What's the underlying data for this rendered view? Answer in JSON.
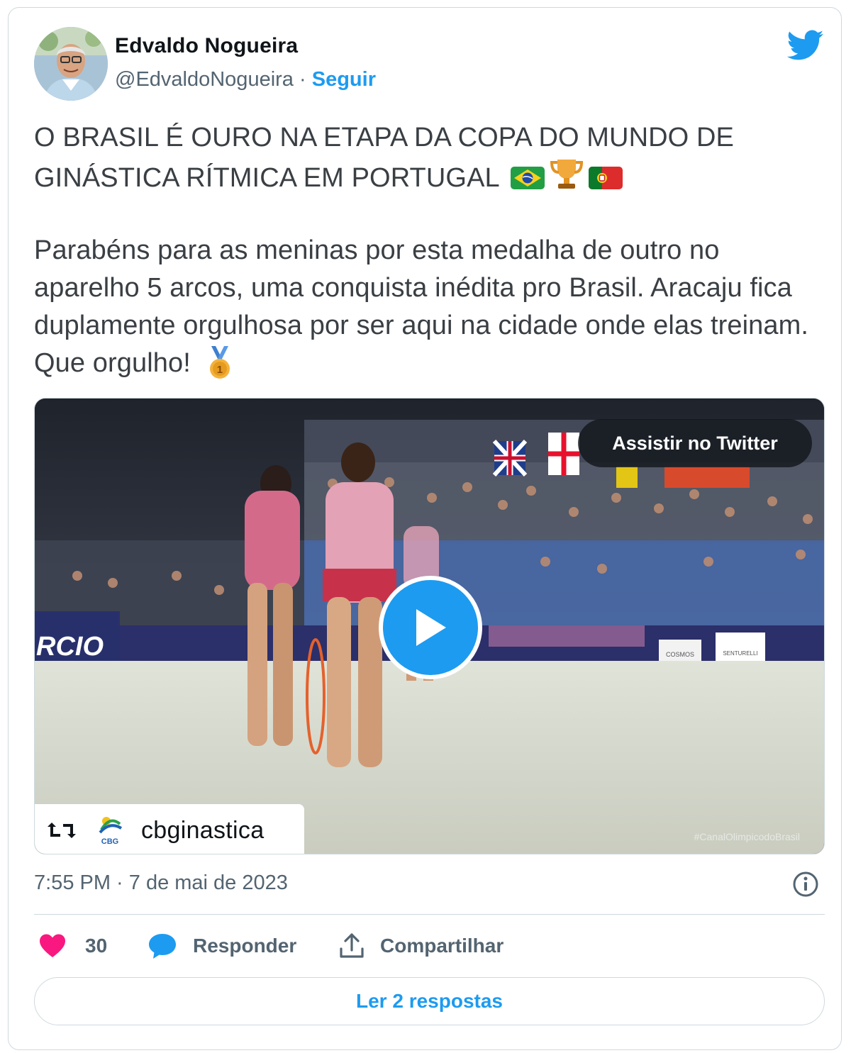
{
  "author": {
    "name": "Edvaldo Nogueira",
    "handle": "@EdvaldoNogueira",
    "separator": "·",
    "follow_label": "Seguir"
  },
  "tweet": {
    "paragraph1": "O BRASIL É OURO NA ETAPA DA COPA DO MUNDO DE GINÁSTICA RÍTMICA EM PORTUGAL",
    "paragraph1_emojis": [
      "brazil-flag",
      "trophy",
      "portugal-flag"
    ],
    "paragraph2": "Parabéns para as meninas por esta medalha de outro no aparelho 5 arcos, uma conquista inédita pro Brasil. Aracaju fica duplamente orgulhosa por ser aqui na cidade onde elas treinam. Que orgulho!",
    "paragraph2_emojis": [
      "first-place-medal"
    ]
  },
  "media": {
    "watch_label": "Assistir no Twitter",
    "retweet_icon": "retweet-icon",
    "source_logo_text": "CBG",
    "source_name": "cbginastica",
    "arena_banner": "RCIO",
    "sponsor_1": "COSMOS",
    "sponsor_2": "SENTURELLI",
    "watermark": "#CanalOlimpicodoBrasil"
  },
  "meta": {
    "timestamp": "7:55 PM · 7 de mai de 2023"
  },
  "actions": {
    "like_count": "30",
    "reply_label": "Responder",
    "share_label": "Compartilhar"
  },
  "read_replies_label": "Ler 2 respostas",
  "colors": {
    "accent": "#1d9bf0",
    "like": "#f91880",
    "text_secondary": "#536471",
    "border": "#cfd9de"
  }
}
